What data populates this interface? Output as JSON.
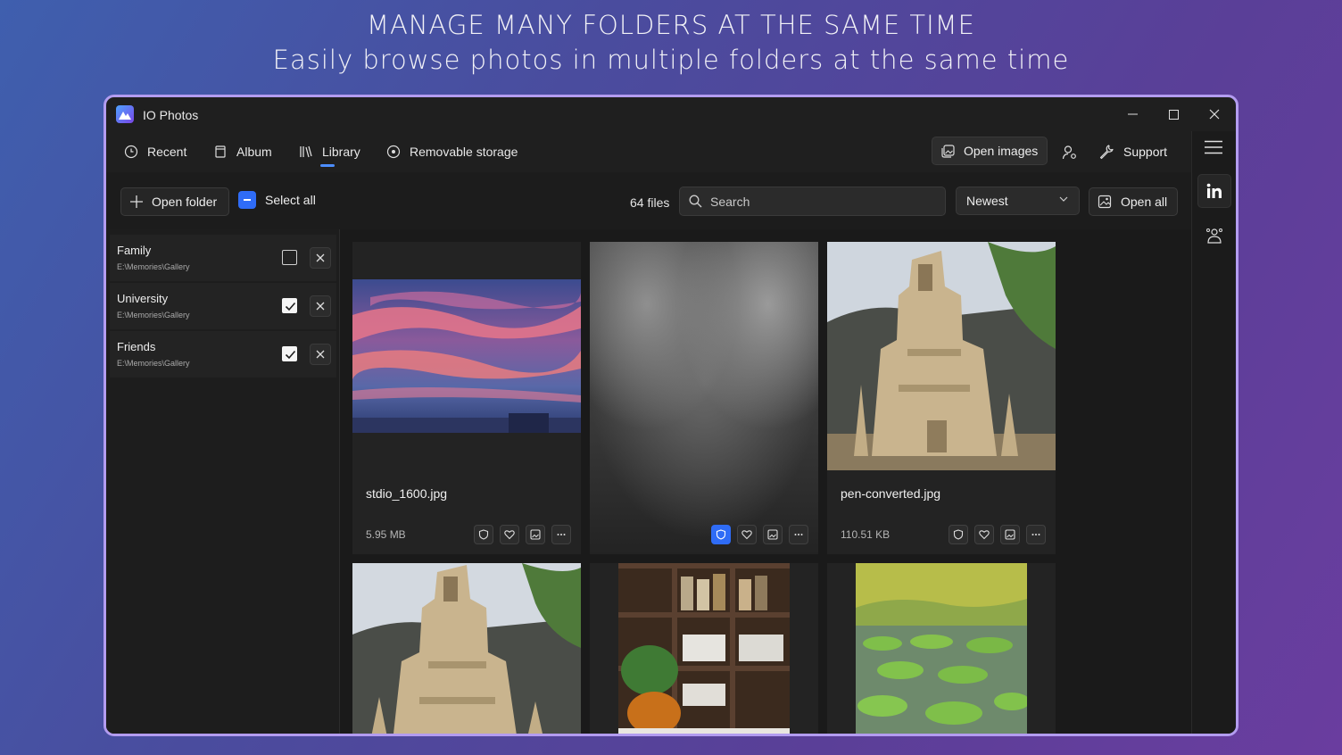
{
  "promo": {
    "headline": "MANAGE MANY FOLDERS AT THE SAME TIME",
    "subheadline": "Easily browse photos in multiple folders at the same time"
  },
  "window": {
    "app_title": "IO Photos"
  },
  "nav": {
    "items": [
      {
        "label": "Recent",
        "icon": "clock-icon"
      },
      {
        "label": "Album",
        "icon": "album-icon"
      },
      {
        "label": "Library",
        "icon": "library-icon",
        "active": true
      },
      {
        "label": "Removable storage",
        "icon": "disc-icon"
      }
    ],
    "open_images_label": "Open images",
    "support_label": "Support"
  },
  "toolbar": {
    "open_folder_label": "Open folder",
    "select_all_label": "Select all",
    "file_count": "64 files",
    "search_placeholder": "Search",
    "sort_value": "Newest",
    "open_all_label": "Open all"
  },
  "folders": [
    {
      "name": "Family",
      "path": "E:\\Memories\\Gallery",
      "checked": false
    },
    {
      "name": "University",
      "path": "E:\\Memories\\Gallery",
      "checked": true
    },
    {
      "name": "Friends",
      "path": "E:\\Memories\\Gallery",
      "checked": true
    }
  ],
  "photos": [
    {
      "name": "stdio_1600.jpg",
      "size": "5.95 MB",
      "thumbnail": "sunset-sky",
      "private": false
    },
    {
      "name": "",
      "size": "",
      "thumbnail": "blurred",
      "private": true
    },
    {
      "name": "pen-converted.jpg",
      "size": "110.51 KB",
      "thumbnail": "sand-castle",
      "private": false
    },
    {
      "name": "",
      "size": "",
      "thumbnail": "sand-castle",
      "private": false
    },
    {
      "name": "",
      "size": "",
      "thumbnail": "kitchen-shelves",
      "private": false
    },
    {
      "name": "",
      "size": "",
      "thumbnail": "lily-pads",
      "private": false
    }
  ],
  "colors": {
    "accent": "#2f6cf6",
    "window_bg": "#1f1f1f",
    "frame_border": "#b39cf0"
  }
}
